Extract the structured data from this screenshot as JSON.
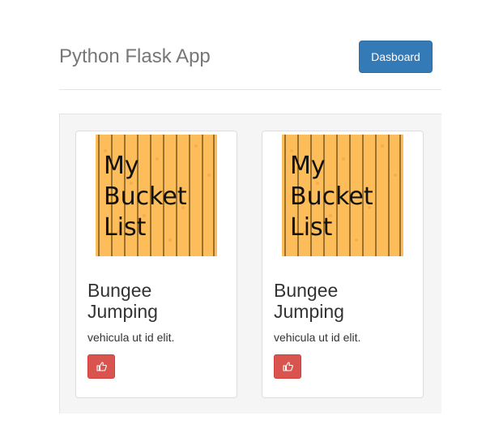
{
  "header": {
    "title": "Python Flask App",
    "dashboard_label": "Dasboard"
  },
  "cards": [
    {
      "image_text": [
        "My",
        "Bucket",
        "List"
      ],
      "title": "Bungee Jumping",
      "text": "vehicula ut id elit."
    },
    {
      "image_text": [
        "My",
        "Bucket",
        "List"
      ],
      "title": "Bungee Jumping",
      "text": "vehicula ut id elit."
    }
  ],
  "colors": {
    "primary": "#337ab7",
    "danger": "#d9534f",
    "thumb_bg": "#fcbd5a",
    "well_bg": "#f5f5f5"
  },
  "icons": {
    "like": "thumbs-up-icon"
  }
}
